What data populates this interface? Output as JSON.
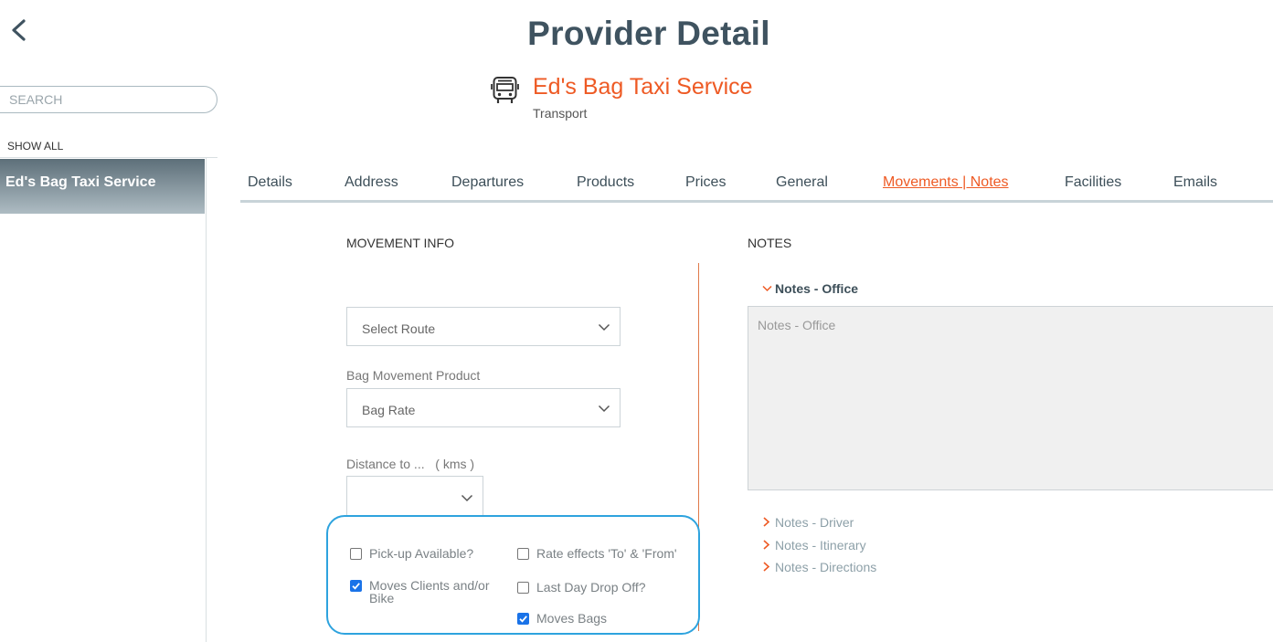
{
  "header": {
    "title": "Provider Detail",
    "provider_name": "Ed's Bag Taxi Service",
    "provider_type": "Transport",
    "back_icon": "chevron-left-icon",
    "provider_icon": "bus-icon"
  },
  "sidebar": {
    "search_placeholder": "SEARCH",
    "show_all": "SHOW ALL",
    "items": [
      {
        "label": "Ed's Bag Taxi Service",
        "selected": true
      }
    ]
  },
  "tabs": [
    {
      "label": "Details"
    },
    {
      "label": "Address"
    },
    {
      "label": "Departures"
    },
    {
      "label": "Products"
    },
    {
      "label": "Prices"
    },
    {
      "label": "General"
    },
    {
      "label": "Movements | Notes",
      "active": true
    },
    {
      "label": "Facilities"
    },
    {
      "label": "Emails"
    }
  ],
  "movement_info": {
    "heading": "MOVEMENT INFO",
    "route_select": {
      "value": "Select Route"
    },
    "bag_product": {
      "label": "Bag Movement Product",
      "value": "Bag Rate"
    },
    "distance": {
      "label": "Distance to ...   ( kms )",
      "value": ""
    },
    "checkboxes": [
      {
        "label": "Pick-up Available?",
        "checked": false
      },
      {
        "label": "Moves Clients and/or Bike",
        "checked": true
      },
      {
        "label": "Rate effects 'To' & 'From'",
        "checked": false
      },
      {
        "label": "Last Day Drop Off?",
        "checked": false
      },
      {
        "label": "Moves Bags",
        "checked": true
      }
    ]
  },
  "notes": {
    "heading": "NOTES",
    "office": {
      "label": "Notes - Office",
      "placeholder": "Notes - Office",
      "expanded": true
    },
    "collapsed": [
      {
        "label": "Notes - Driver"
      },
      {
        "label": "Notes - Itinerary"
      },
      {
        "label": "Notes - Directions"
      }
    ]
  },
  "colors": {
    "accent": "#ee5a24",
    "title": "#3f5360",
    "highlight_border": "#2ea3de",
    "checkbox_checked": "#1a73e8"
  }
}
